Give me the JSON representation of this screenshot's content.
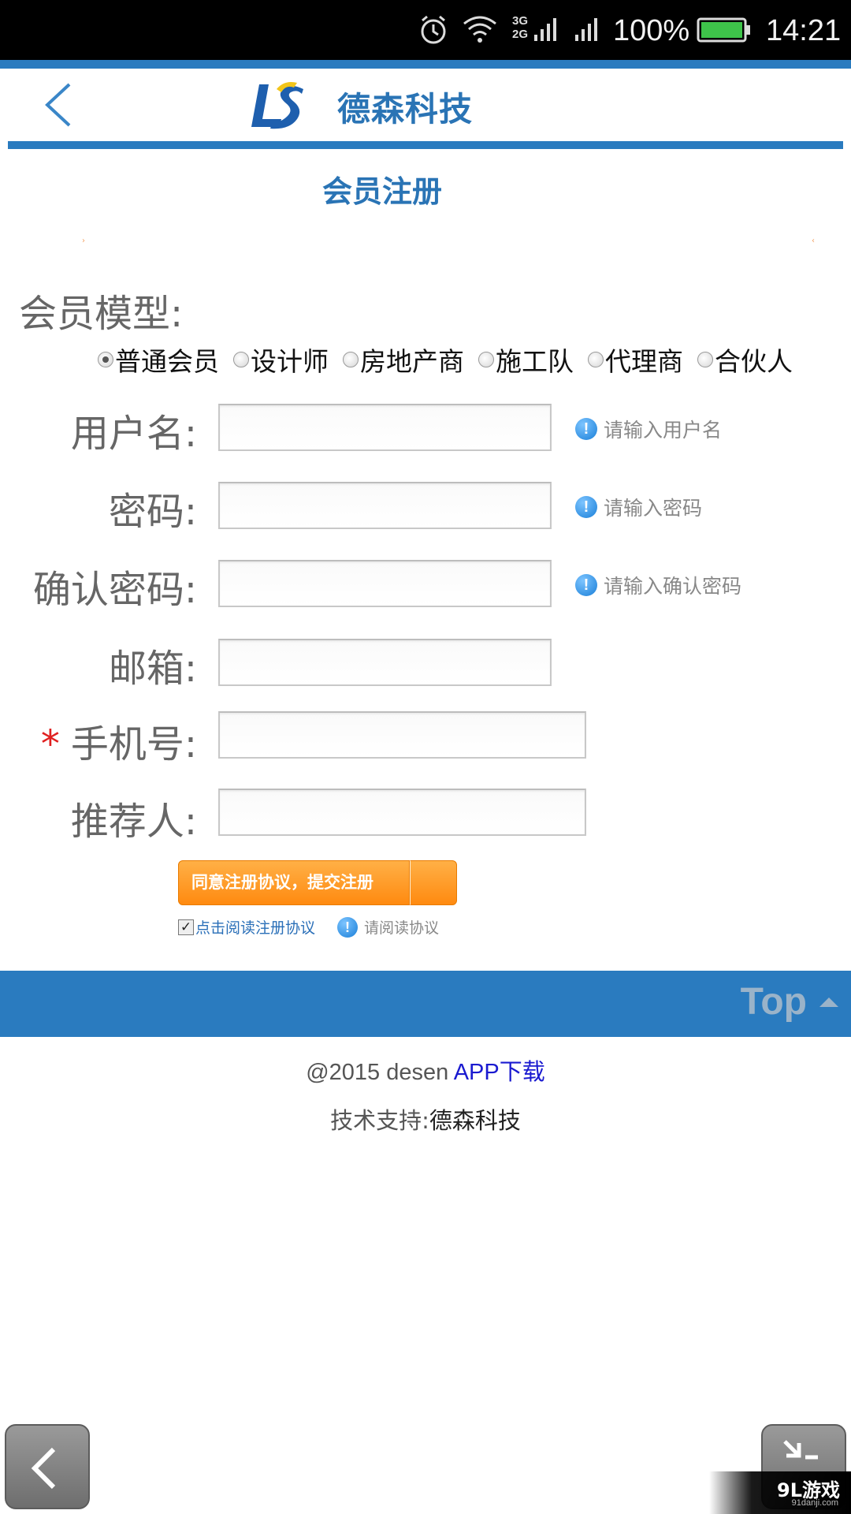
{
  "status_bar": {
    "network": "3G\n2G",
    "battery": "100%",
    "time": "14:21"
  },
  "header": {
    "brand": "德森科技",
    "back_icon": "chevron-left-icon",
    "logo": "ds-logo"
  },
  "page_title": "会员注册",
  "form": {
    "model_label": "会员模型:",
    "model_options": [
      "普通会员",
      "设计师",
      "房地产商",
      "施工队",
      "代理商",
      "合伙人"
    ],
    "model_selected": "普通会员",
    "fields": {
      "username": {
        "label": "用户名:",
        "value": "",
        "hint": "请输入用户名"
      },
      "password": {
        "label": "密码:",
        "value": "",
        "hint": "请输入密码"
      },
      "confirm": {
        "label": "确认密码:",
        "value": "",
        "hint": "请输入确认密码"
      },
      "email": {
        "label": "邮箱:",
        "value": ""
      },
      "phone": {
        "label": "手机号:",
        "required_mark": "*",
        "value": ""
      },
      "referrer": {
        "label": "推荐人:",
        "value": ""
      }
    },
    "submit_label": "同意注册协议，提交注册",
    "agree_checked": true,
    "agree_link": "点击阅读注册协议",
    "agree_hint": "请阅读协议"
  },
  "footer": {
    "top_label": "Top",
    "copyright": "@2015 desen ",
    "app_link": "APP下载",
    "support_label": "技术支持:",
    "support_name": "德森科技"
  },
  "watermark": {
    "text": "9L游戏",
    "sub": "91danji.com"
  },
  "colors": {
    "brand_blue": "#2a7bbf",
    "title_blue": "#2a74b5",
    "button_orange": "#ff9a2a",
    "required_red": "#e02020",
    "link_blue": "#1a1ad0"
  }
}
